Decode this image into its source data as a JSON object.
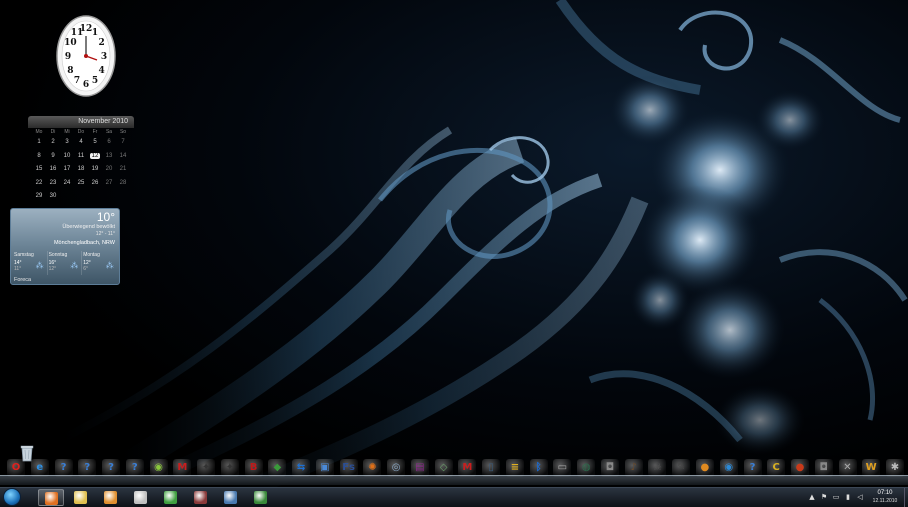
{
  "clock": {
    "numerals": [
      "12",
      "1",
      "2",
      "3",
      "4",
      "5",
      "6",
      "7",
      "8",
      "9",
      "10",
      "11"
    ]
  },
  "calendar": {
    "month_label": "November 2010",
    "weekdays": [
      "Mo",
      "Di",
      "Mi",
      "Do",
      "Fr",
      "Sa",
      "So"
    ],
    "weeks": [
      [
        "1",
        "2",
        "3",
        "4",
        "5",
        "6",
        "7"
      ],
      [
        "8",
        "9",
        "10",
        "11",
        "12",
        "13",
        "14"
      ],
      [
        "15",
        "16",
        "17",
        "18",
        "19",
        "20",
        "21"
      ],
      [
        "22",
        "23",
        "24",
        "25",
        "26",
        "27",
        "28"
      ],
      [
        "29",
        "30",
        "",
        "",
        "",
        "",
        ""
      ]
    ],
    "today": "12"
  },
  "weather": {
    "temperature": "10°",
    "condition": "Überwiegend bewölkt",
    "range": "12° - 11°",
    "location": "Mönchengladbach, NRW",
    "forecast": [
      {
        "day": "Samstag",
        "high": "14°",
        "low": "11°",
        "icon": "rain-icon"
      },
      {
        "day": "Sonntag",
        "high": "16°",
        "low": "12°",
        "icon": "rain-icon"
      },
      {
        "day": "Montag",
        "high": "12°",
        "low": "6°",
        "icon": "rain-icon"
      }
    ],
    "source": "Foreca"
  },
  "dock": {
    "recycle_bin": "recycle-bin-icon",
    "icons": [
      {
        "name": "opera-icon",
        "glyph": "O",
        "color": "#e0201c"
      },
      {
        "name": "internet-explorer-icon",
        "glyph": "e",
        "color": "#2f8fe0"
      },
      {
        "name": "help-icon",
        "glyph": "?",
        "color": "#3a7fd6"
      },
      {
        "name": "help-icon",
        "glyph": "?",
        "color": "#3a7fd6"
      },
      {
        "name": "help-icon",
        "glyph": "?",
        "color": "#3a7fd6"
      },
      {
        "name": "help-icon",
        "glyph": "?",
        "color": "#3a7fd6"
      },
      {
        "name": "globe-icon",
        "glyph": "◉",
        "color": "#8ac83c"
      },
      {
        "name": "mcafee-icon",
        "glyph": "M",
        "color": "#c81e1e"
      },
      {
        "name": "crow-icon",
        "glyph": "✦",
        "color": "#333"
      },
      {
        "name": "crow-icon",
        "glyph": "✦",
        "color": "#333"
      },
      {
        "name": "boxer-icon",
        "glyph": "B",
        "color": "#c01818"
      },
      {
        "name": "turtle-icon",
        "glyph": "◆",
        "color": "#3a9a3a"
      },
      {
        "name": "teamviewer-icon",
        "glyph": "⇆",
        "color": "#1c6fd2"
      },
      {
        "name": "windows-update-icon",
        "glyph": "▣",
        "color": "#4a8ad8"
      },
      {
        "name": "fs-icon",
        "glyph": "Fs",
        "color": "#2a4e96"
      },
      {
        "name": "fire-icon",
        "glyph": "✺",
        "color": "#e07018"
      },
      {
        "name": "network-icon",
        "glyph": "◎",
        "color": "#8aaaca"
      },
      {
        "name": "winrar-icon",
        "glyph": "▤",
        "color": "#8a2a8a"
      },
      {
        "name": "gem-icon",
        "glyph": "◇",
        "color": "#6aa06a"
      },
      {
        "name": "mcafee-icon",
        "glyph": "M",
        "color": "#c81e1e"
      },
      {
        "name": "phone-icon",
        "glyph": "▯",
        "color": "#3a5a7a"
      },
      {
        "name": "stripes-icon",
        "glyph": "≡",
        "color": "#e0b020"
      },
      {
        "name": "bluetooth-icon",
        "glyph": "ᛒ",
        "color": "#1a6ad0"
      },
      {
        "name": "printer-icon",
        "glyph": "▭",
        "color": "#aaaaaa"
      },
      {
        "name": "drive-icon",
        "glyph": "◍",
        "color": "#2a6a4a"
      },
      {
        "name": "camera-icon",
        "glyph": "◘",
        "color": "#888888"
      },
      {
        "name": "guitar-icon",
        "glyph": "♪",
        "color": "#6a4a2a"
      },
      {
        "name": "skull-icon",
        "glyph": "☠",
        "color": "#555555"
      },
      {
        "name": "pen-icon",
        "glyph": "✎",
        "color": "#444444"
      },
      {
        "name": "pumpkin-icon",
        "glyph": "●",
        "color": "#e08a20"
      },
      {
        "name": "globe-icon",
        "glyph": "◉",
        "color": "#2a8ad8"
      },
      {
        "name": "help-icon",
        "glyph": "?",
        "color": "#3a7fd6"
      },
      {
        "name": "c-icon",
        "glyph": "C",
        "color": "#d8b020"
      },
      {
        "name": "ball-icon",
        "glyph": "●",
        "color": "#c83a1a"
      },
      {
        "name": "camera-icon",
        "glyph": "◘",
        "color": "#888888"
      },
      {
        "name": "tools-icon",
        "glyph": "✕",
        "color": "#aaaaaa"
      },
      {
        "name": "winamp-icon",
        "glyph": "W",
        "color": "#e0a020"
      },
      {
        "name": "settings-icon",
        "glyph": "✱",
        "color": "#bbbbbb"
      }
    ]
  },
  "taskbar": {
    "start": "windows-start-icon",
    "pinned": [
      {
        "name": "firefox-icon",
        "color": "#e07020",
        "active": true
      },
      {
        "name": "explorer-folder-icon",
        "color": "#e0c050",
        "active": false
      },
      {
        "name": "media-player-icon",
        "color": "#e09030",
        "active": false
      },
      {
        "name": "network-tool-icon",
        "color": "#c0c0c0",
        "active": false
      },
      {
        "name": "chrome-icon",
        "color": "#40a040",
        "active": false
      },
      {
        "name": "app-icon",
        "color": "#8a3a3a",
        "active": false
      },
      {
        "name": "network-globe-icon",
        "color": "#4a7ab0",
        "active": false
      },
      {
        "name": "remote-desktop-icon",
        "color": "#3a8a3a",
        "active": false
      }
    ],
    "tray": {
      "icons": [
        "chevron-up-icon",
        "flag-icon",
        "monitor-icon",
        "network-icon",
        "volume-icon"
      ],
      "time": "07:10",
      "date": "12.11.2010"
    }
  }
}
